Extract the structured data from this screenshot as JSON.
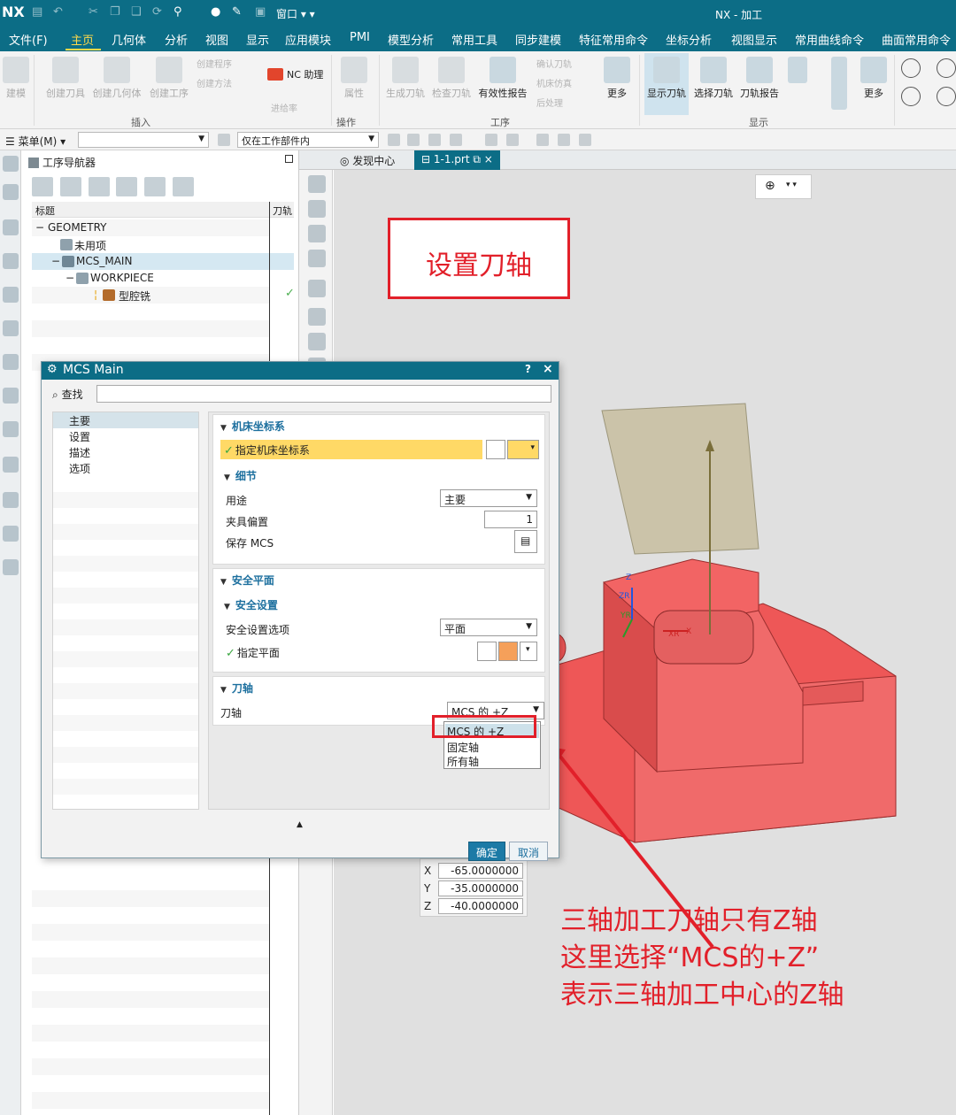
{
  "colors": {
    "teal": "#0c6d86",
    "accent": "#ffd94a",
    "red": "#e2202a",
    "part": "#f05a5a",
    "highlight": "#ffd966"
  },
  "title_bar": {
    "logo": "NX",
    "window_menu": "窗口",
    "title": "NX - 加工"
  },
  "menu_bar": [
    "文件(F)",
    "主页",
    "几何体",
    "分析",
    "视图",
    "显示",
    "应用模块",
    "PMI",
    "模型分析",
    "常用工具",
    "同步建模",
    "特征常用命令",
    "坐标分析",
    "视图显示",
    "常用曲线命令",
    "曲面常用命令"
  ],
  "ribbon": {
    "large_buttons": [
      "创建刀具",
      "创建几何体",
      "创建工序",
      "属性",
      "生成刀轨",
      "检查刀轨",
      "有效性报告",
      "更多",
      "显示刀轨",
      "选择刀轨",
      "刀轨报告",
      "更多"
    ],
    "small_buttons": [
      "创建程序",
      "创建方法",
      "NC 助理",
      "进给率",
      "确认刀轨",
      "机床仿真",
      "后处理"
    ],
    "edge_button": "建模",
    "groups": [
      "插入",
      "操作",
      "工序",
      "显示"
    ]
  },
  "selection_bar": {
    "menu": "菜单(M)",
    "filter": "仅在工作部件内"
  },
  "navigator": {
    "title": "工序导航器",
    "columns": [
      "标题",
      "刀轨"
    ],
    "rows": [
      {
        "label": "GEOMETRY"
      },
      {
        "label": "未用项"
      },
      {
        "label": "MCS_MAIN"
      },
      {
        "label": "WORKPIECE"
      },
      {
        "label": "型腔铣",
        "status": "✓"
      }
    ]
  },
  "tabs": [
    "发现中心",
    "1-1.prt"
  ],
  "callout": "设置刀轴",
  "note": [
    "三轴加工刀轴只有Z轴",
    "这里选择“MCS的+Z”",
    "表示三轴加工中心的Z轴"
  ],
  "coords": {
    "labels": [
      "X",
      "Y",
      "Z"
    ],
    "values": [
      "-65.0000000",
      "-35.0000000",
      "-40.0000000"
    ]
  },
  "dialog": {
    "title": "MCS Main",
    "help": "?",
    "find": "查找",
    "categories": [
      "主要",
      "设置",
      "描述",
      "选项"
    ],
    "mcs_section": "机床坐标系",
    "specify_mcs": "指定机床坐标系",
    "detail_section": "细节",
    "purpose_label": "用途",
    "purpose_value": "主要",
    "fixture_label": "夹具偏置",
    "fixture_value": "1",
    "save_mcs": "保存 MCS",
    "safety_section": "安全平面",
    "safety_settings": "安全设置",
    "safety_option_label": "安全设置选项",
    "safety_option_value": "平面",
    "specify_plane": "指定平面",
    "axis_section": "刀轴",
    "axis_label": "刀轴",
    "axis_value": "MCS 的 +Z",
    "axis_options": [
      "MCS 的 +Z",
      "固定轴",
      "所有轴"
    ],
    "ok": "确定",
    "cancel": "取消"
  },
  "graphics_labels": {
    "zr": "ZR",
    "yr": "YR",
    "xr": "XR",
    "x": "X",
    "z": "Z"
  }
}
